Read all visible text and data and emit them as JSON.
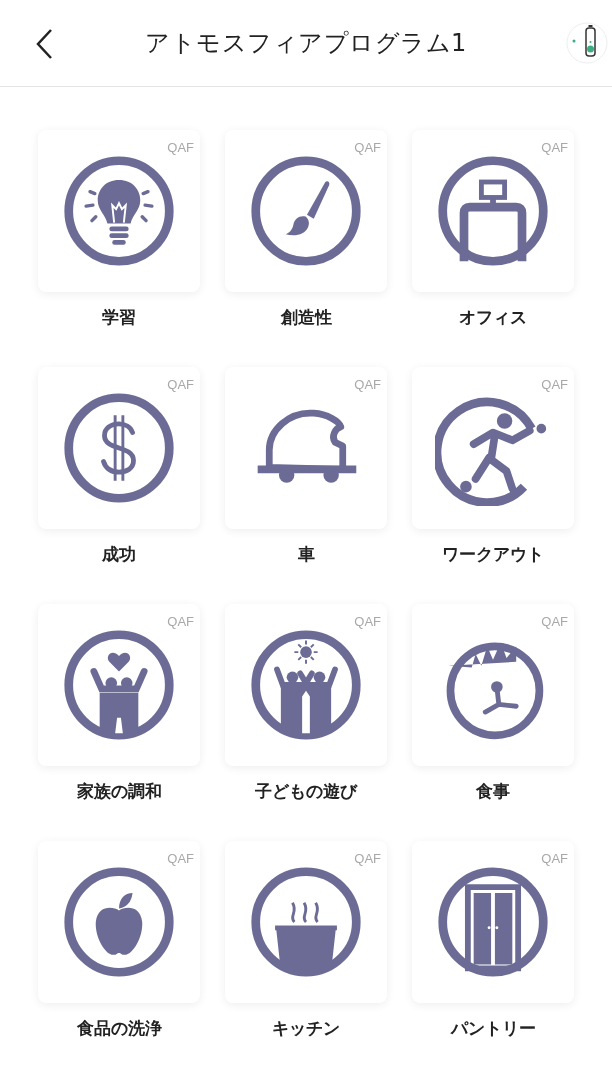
{
  "header": {
    "title": "アトモスフィアプログラム1"
  },
  "tiles": [
    {
      "kind": "bulb",
      "badge": "QAF",
      "label": "学習"
    },
    {
      "kind": "brush",
      "badge": "QAF",
      "label": "創造性"
    },
    {
      "kind": "office",
      "badge": "QAF",
      "label": "オフィス"
    },
    {
      "kind": "dollar",
      "badge": "QAF",
      "label": "成功"
    },
    {
      "kind": "car",
      "badge": "QAF",
      "label": "車"
    },
    {
      "kind": "runner",
      "badge": "QAF",
      "label": "ワークアウト"
    },
    {
      "kind": "family",
      "badge": "QAF",
      "label": "家族の調和"
    },
    {
      "kind": "kids",
      "badge": "QAF",
      "label": "子どもの遊び"
    },
    {
      "kind": "meal",
      "badge": "QAF",
      "label": "食事"
    },
    {
      "kind": "apple",
      "badge": "QAF",
      "label": "食品の洗浄"
    },
    {
      "kind": "pot",
      "badge": "QAF",
      "label": "キッチン"
    },
    {
      "kind": "pantry",
      "badge": "QAF",
      "label": "パントリー"
    }
  ]
}
